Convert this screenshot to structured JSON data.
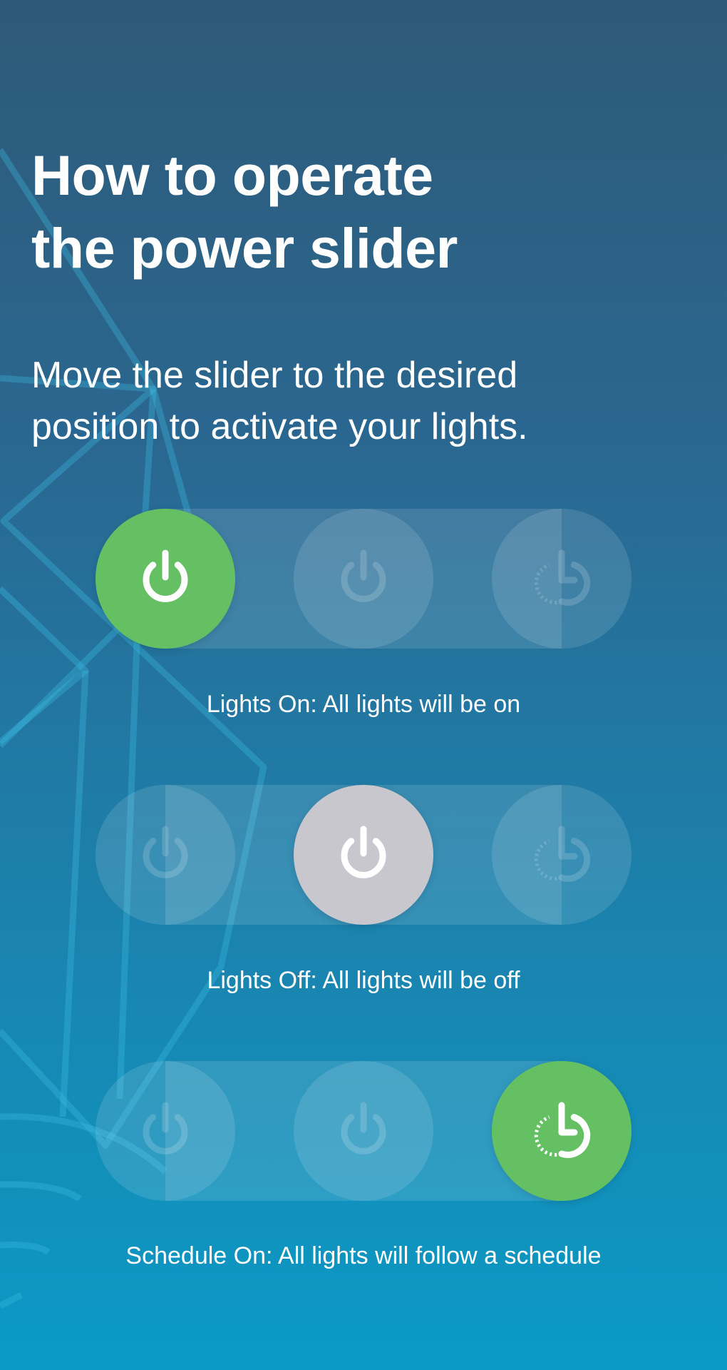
{
  "header": {
    "title_line1": "How to operate",
    "title_line2": "the power slider",
    "subtitle_line1": "Move the slider to the desired",
    "subtitle_line2": "position to activate your lights."
  },
  "sliders": [
    {
      "state": "lights-on",
      "selected_index": 0,
      "caption": "Lights On: All lights will be on",
      "options": [
        "power-icon",
        "power-icon",
        "schedule-icon"
      ],
      "active_color": "#65bf63"
    },
    {
      "state": "lights-off",
      "selected_index": 1,
      "caption": "Lights Off: All lights will be off",
      "options": [
        "power-icon",
        "power-icon",
        "schedule-icon"
      ],
      "active_color": "#c8c7cd"
    },
    {
      "state": "schedule-on",
      "selected_index": 2,
      "caption": "Schedule On: All lights will follow a schedule",
      "options": [
        "power-icon",
        "power-icon",
        "schedule-icon"
      ],
      "active_color": "#65bf63"
    }
  ],
  "colors": {
    "background_top": "#2e5a78",
    "background_bottom": "#0b9ac6",
    "active_green": "#65bf63",
    "off_gray": "#c8c7cd"
  }
}
